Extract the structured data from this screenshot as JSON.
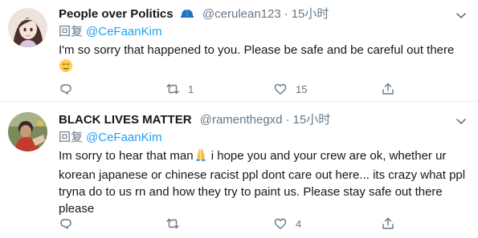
{
  "tweets": [
    {
      "display_name": "People over Politics",
      "handle": "@cerulean123",
      "separator": "·",
      "time": "15小时",
      "reply_prefix": "回复",
      "reply_to": "@CeFaanKim",
      "text": "I'm so sorry that happened to you. Please be safe and be careful out there",
      "text_emoji": "relieved-face-emoji",
      "retweets": "1",
      "likes": "15",
      "icons": [
        "cap-badge-icon",
        "chevron-down-icon",
        "reply-icon",
        "retweet-icon",
        "like-icon",
        "share-icon"
      ]
    },
    {
      "display_name": "BLACK LIVES MATTER",
      "handle": "@ramenthegxd",
      "separator": "·",
      "time": "15小时",
      "reply_prefix": "回复",
      "reply_to": "@CeFaanKim",
      "text_before_emoji": "Im sorry to hear that man",
      "text_emoji": "folded-hands-emoji",
      "text_after_emoji": " i hope you and your crew are ok, whether ur korean japanese or chinese racist ppl dont care out here... its crazy what ppl tryna do to us rn and how they try to paint us. Please stay safe out there please",
      "likes": "4",
      "icons": [
        "chevron-down-icon",
        "reply-icon",
        "retweet-icon",
        "like-icon",
        "share-icon"
      ]
    }
  ],
  "colors": {
    "text": "#14171a",
    "secondary": "#657786",
    "link": "#1da1f2",
    "divider": "#e6ecf0",
    "badge": "#1b74c5"
  }
}
